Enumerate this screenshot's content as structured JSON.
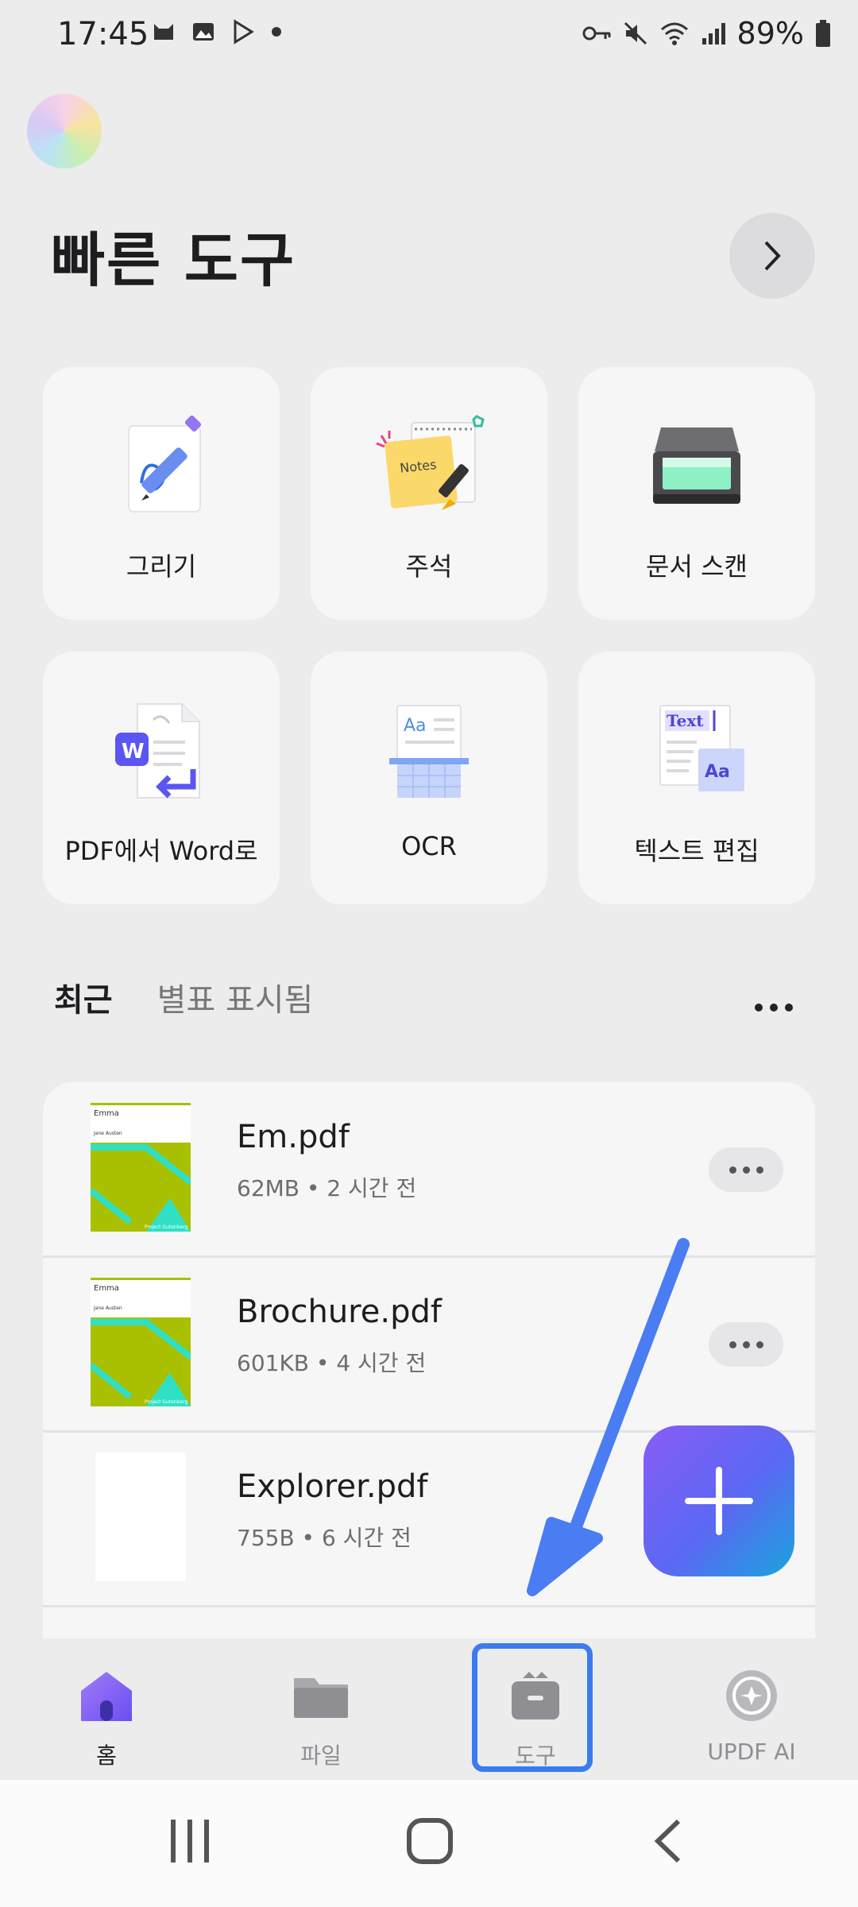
{
  "status_bar": {
    "time": "17:45",
    "battery": "89%",
    "left_icons": [
      "cat-icon",
      "gallery-icon",
      "play-store-icon",
      "dot-icon"
    ],
    "right_icons": [
      "vpn-key-icon",
      "mute-icon",
      "wifi-icon",
      "signal-icon",
      "battery-icon"
    ]
  },
  "quick_tools": {
    "title": "빠른 도구",
    "items": [
      {
        "label": "그리기",
        "icon": "draw-icon"
      },
      {
        "label": "주석",
        "icon": "annotation-icon"
      },
      {
        "label": "문서 스캔",
        "icon": "scanner-icon"
      },
      {
        "label": "PDF에서 Word로",
        "icon": "pdf-to-word-icon"
      },
      {
        "label": "OCR",
        "icon": "ocr-icon"
      },
      {
        "label": "텍스트 편집",
        "icon": "text-edit-icon"
      }
    ]
  },
  "recent": {
    "tabs": [
      "최근",
      "별표 표시됨"
    ],
    "files": [
      {
        "name": "Em.pdf",
        "meta": "62MB • 2 시간 전"
      },
      {
        "name": "Brochure.pdf",
        "meta": "601KB • 4 시간 전"
      },
      {
        "name": "Explorer.pdf",
        "meta": "755B • 6 시간 전"
      }
    ],
    "thumb_text": {
      "title": "Emma",
      "author": "Jane Austen",
      "publisher": "Project Gutenberg"
    }
  },
  "bottom_nav": {
    "items": [
      {
        "label": "홈",
        "icon": "home-icon"
      },
      {
        "label": "파일",
        "icon": "folder-icon"
      },
      {
        "label": "도구",
        "icon": "toolbox-icon"
      },
      {
        "label": "UPDF AI",
        "icon": "ai-icon"
      }
    ]
  },
  "colors": {
    "accent": "#7b5cf5",
    "highlight": "#3a7cf0",
    "background": "#ececed"
  }
}
